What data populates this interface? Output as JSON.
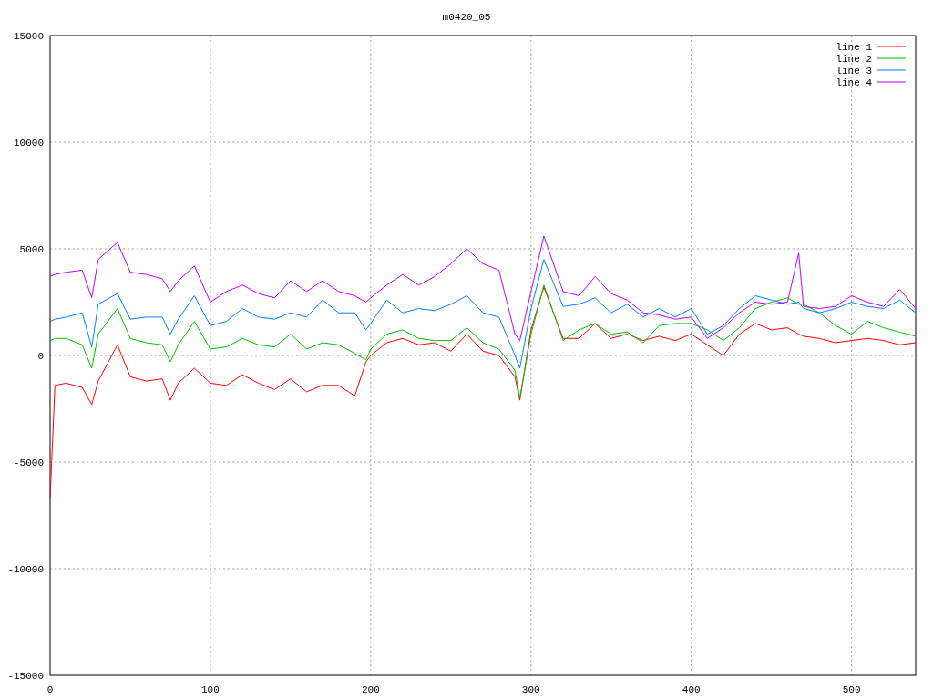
{
  "chart_data": {
    "type": "line",
    "title": "m0420_05",
    "x": [
      0,
      3,
      10,
      20,
      26,
      30,
      42,
      50,
      60,
      70,
      75,
      80,
      90,
      100,
      110,
      120,
      130,
      140,
      150,
      160,
      170,
      180,
      190,
      197,
      200,
      210,
      220,
      230,
      240,
      250,
      260,
      270,
      280,
      290,
      293,
      300,
      308,
      320,
      330,
      340,
      350,
      360,
      370,
      380,
      390,
      400,
      410,
      420,
      430,
      440,
      450,
      460,
      467,
      470,
      480,
      490,
      500,
      510,
      520,
      530,
      540
    ],
    "series": [
      {
        "name": "line 1",
        "color": "#ff0000",
        "values": [
          -6700,
          -1400,
          -1300,
          -1500,
          -2300,
          -1200,
          500,
          -1000,
          -1200,
          -1100,
          -2100,
          -1300,
          -600,
          -1300,
          -1400,
          -900,
          -1300,
          -1600,
          -1100,
          -1700,
          -1400,
          -1400,
          -1900,
          -300,
          0,
          600,
          800,
          500,
          600,
          200,
          1000,
          200,
          0,
          -1000,
          -2100,
          1200,
          3200,
          800,
          800,
          1500,
          800,
          1000,
          700,
          900,
          700,
          1000,
          500,
          0,
          1000,
          1500,
          1200,
          1300,
          1000,
          900,
          800,
          600,
          700,
          800,
          700,
          500,
          600
        ]
      },
      {
        "name": "line 2",
        "color": "#00c000",
        "values": [
          700,
          800,
          800,
          500,
          -600,
          1000,
          2200,
          800,
          600,
          500,
          -300,
          500,
          1600,
          300,
          400,
          800,
          500,
          400,
          1000,
          300,
          600,
          500,
          100,
          -200,
          300,
          1000,
          1200,
          800,
          700,
          700,
          1300,
          600,
          300,
          -700,
          -2000,
          1000,
          3300,
          700,
          1200,
          1500,
          1000,
          1100,
          600,
          1400,
          1500,
          1500,
          1200,
          700,
          1300,
          2200,
          2500,
          2700,
          2400,
          2400,
          2000,
          1400,
          1000,
          1600,
          1300,
          1100,
          900
        ]
      },
      {
        "name": "line 3",
        "color": "#0080ff",
        "values": [
          1600,
          1700,
          1800,
          2000,
          400,
          2400,
          2900,
          1700,
          1800,
          1800,
          1000,
          1700,
          2800,
          1400,
          1600,
          2200,
          1800,
          1700,
          2000,
          1800,
          2600,
          2000,
          2000,
          1200,
          1500,
          2600,
          2000,
          2200,
          2100,
          2400,
          2800,
          2000,
          1800,
          0,
          -600,
          2200,
          4500,
          2300,
          2400,
          2700,
          2000,
          2400,
          1800,
          2200,
          1800,
          2200,
          1000,
          1400,
          2200,
          2800,
          2600,
          2400,
          2500,
          2200,
          2000,
          2200,
          2500,
          2300,
          2200,
          2600,
          2000
        ]
      },
      {
        "name": "line 4",
        "color": "#c000ff",
        "values": [
          3700,
          3800,
          3900,
          4000,
          2700,
          4500,
          5300,
          3900,
          3800,
          3600,
          3000,
          3500,
          4200,
          2500,
          3000,
          3300,
          2900,
          2700,
          3500,
          3000,
          3500,
          3000,
          2800,
          2500,
          2700,
          3300,
          3800,
          3300,
          3700,
          4300,
          5000,
          4300,
          4000,
          1000,
          700,
          3000,
          5600,
          3000,
          2800,
          3700,
          2900,
          2600,
          2000,
          1900,
          1700,
          1800,
          800,
          1300,
          2000,
          2500,
          2400,
          2500,
          4800,
          2300,
          2200,
          2300,
          2800,
          2500,
          2300,
          3100,
          2200
        ]
      }
    ],
    "xlim": [
      0,
      540
    ],
    "ylim": [
      -15000,
      15000
    ],
    "xticks": [
      0,
      100,
      200,
      300,
      400,
      500
    ],
    "yticks": [
      -15000,
      -10000,
      -5000,
      0,
      5000,
      10000,
      15000
    ],
    "grid": true,
    "legend": true
  }
}
